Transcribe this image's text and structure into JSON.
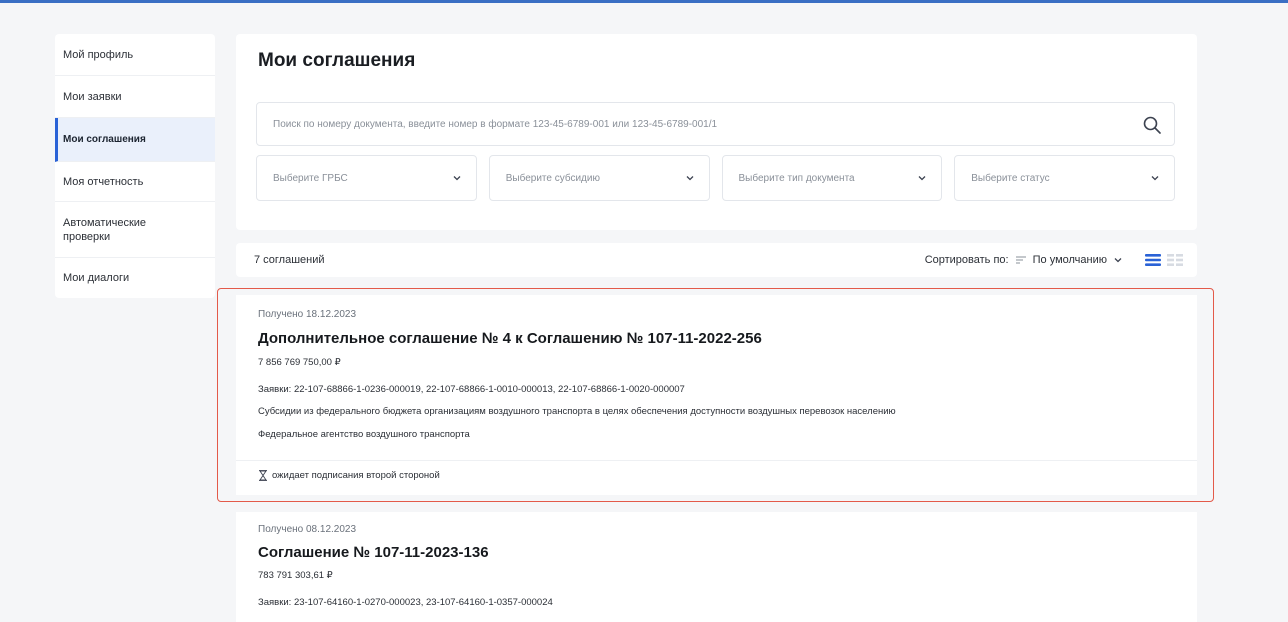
{
  "sidebar": {
    "items": [
      {
        "label": "Мой профиль"
      },
      {
        "label": "Мои заявки"
      },
      {
        "label": "Мои соглашения"
      },
      {
        "label": "Моя отчетность"
      },
      {
        "label": "Автоматические проверки"
      },
      {
        "label": "Мои диалоги"
      }
    ],
    "active_index": 2
  },
  "main": {
    "title": "Мои соглашения",
    "search": {
      "placeholder": "Поиск по номеру документа, введите номер в формате 123-45-6789-001 или 123-45-6789-001/1",
      "value": "",
      "icon": "search-icon"
    },
    "filters": [
      {
        "placeholder": "Выберите ГРБС"
      },
      {
        "placeholder": "Выберите субсидию"
      },
      {
        "placeholder": "Выберите тип документа"
      },
      {
        "placeholder": "Выберите статус"
      }
    ]
  },
  "list_header": {
    "count_text": "7 соглашений",
    "sort_label": "Сортировать по:",
    "sort_value": "По умолчанию",
    "view_modes": [
      "list-view-icon",
      "grid-view-icon"
    ],
    "active_view": "list"
  },
  "agreements": [
    {
      "received": "Получено 18.12.2023",
      "title": "Дополнительное соглашение № 4 к Соглашению № 107-11-2022-256",
      "amount": "7 856 769 750,00 ₽",
      "requests": "Заявки: 22-107-68866-1-0236-000019, 22-107-68866-1-0010-000013, 22-107-68866-1-0020-000007",
      "subsidy": "Субсидии из федерального бюджета организациям воздушного транспорта в целях обеспечения доступности воздушных перевозок населению",
      "agency": "Федеральное агентство воздушного транспорта",
      "status": "ожидает подписания второй стороной",
      "highlighted": true
    },
    {
      "received": "Получено 08.12.2023",
      "title": "Соглашение № 107-11-2023-136",
      "amount": "783 791 303,61 ₽",
      "requests": "Заявки: 23-107-64160-1-0270-000023, 23-107-64160-1-0357-000024",
      "highlighted": false
    }
  ],
  "colors": {
    "accent": "#2a62d6",
    "highlight_border": "#e35a4a",
    "page_background": "#f5f6f8"
  }
}
